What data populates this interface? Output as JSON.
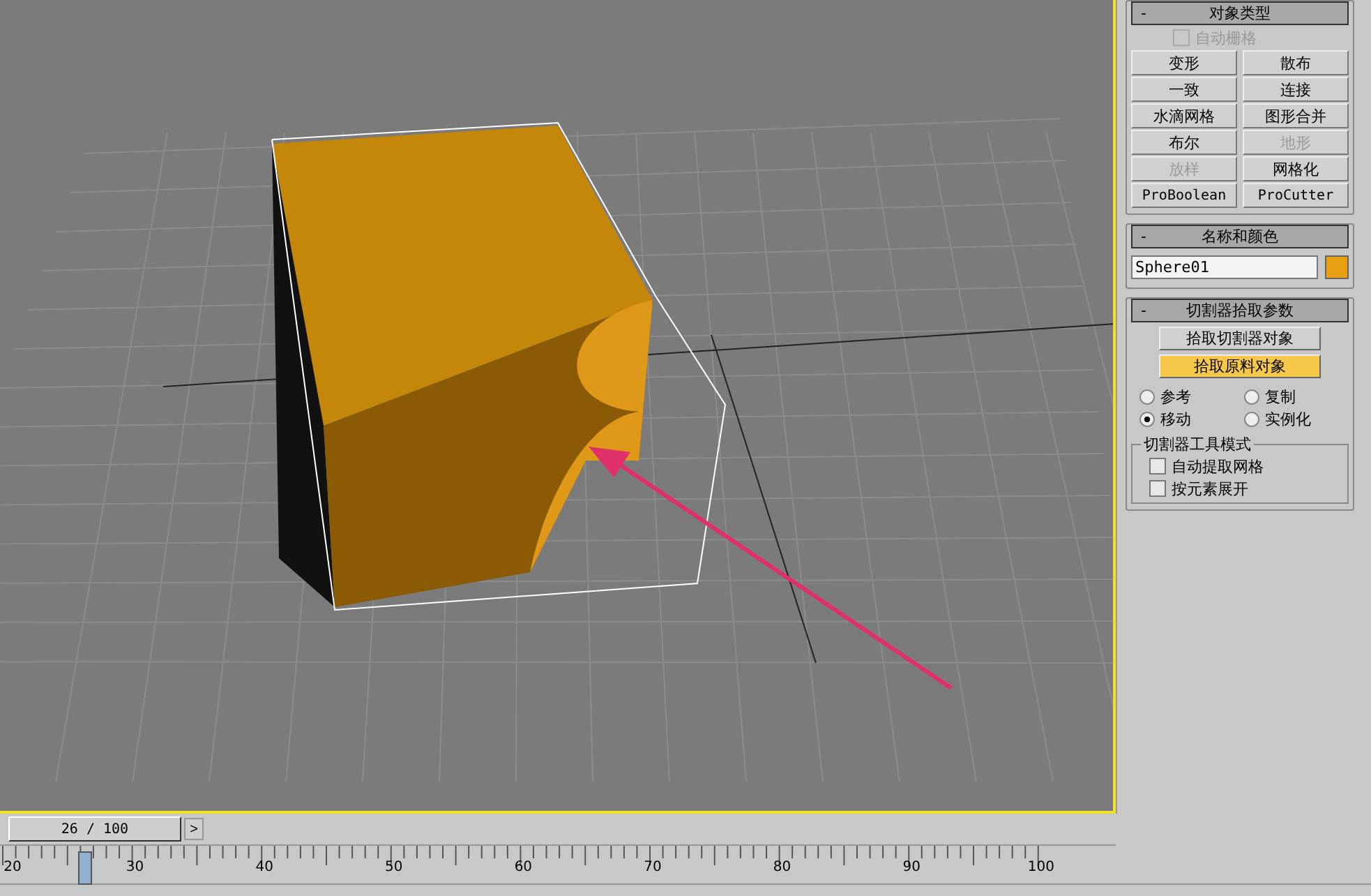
{
  "panel": {
    "object_type": {
      "collapse": "-",
      "title": "对象类型",
      "autogrid": {
        "label": "自动栅格",
        "checked": false,
        "disabled": true
      },
      "buttons": [
        {
          "label": "变形",
          "disabled": false,
          "kind": "text"
        },
        {
          "label": "散布",
          "disabled": false,
          "kind": "text"
        },
        {
          "label": "一致",
          "disabled": false,
          "kind": "text"
        },
        {
          "label": "连接",
          "disabled": false,
          "kind": "text"
        },
        {
          "label": "水滴网格",
          "disabled": false,
          "kind": "text"
        },
        {
          "label": "图形合并",
          "disabled": false,
          "kind": "text"
        },
        {
          "label": "布尔",
          "disabled": false,
          "kind": "text"
        },
        {
          "label": "地形",
          "disabled": true,
          "kind": "text"
        },
        {
          "label": "放样",
          "disabled": true,
          "kind": "text"
        },
        {
          "label": "网格化",
          "disabled": false,
          "kind": "text"
        },
        {
          "label": "ProBoolean",
          "disabled": false,
          "kind": "mono"
        },
        {
          "label": "ProCutter",
          "disabled": false,
          "kind": "mono"
        }
      ]
    },
    "name_color": {
      "collapse": "-",
      "title": "名称和颜色",
      "name": "Sphere01",
      "color": "#e8a010"
    },
    "cutter": {
      "collapse": "-",
      "title": "切割器拾取参数",
      "pick_buttons": [
        {
          "label": "拾取切割器对象",
          "selected": false
        },
        {
          "label": "拾取原料对象",
          "selected": true
        }
      ],
      "radios": [
        {
          "label": "参考",
          "selected": false
        },
        {
          "label": "复制",
          "selected": false
        },
        {
          "label": "移动",
          "selected": true
        },
        {
          "label": "实例化",
          "selected": false
        }
      ],
      "mode": {
        "title": "切割器工具模式",
        "options": [
          {
            "label": "自动提取网格",
            "checked": false
          },
          {
            "label": "按元素展开",
            "checked": false
          }
        ]
      }
    }
  },
  "timeline": {
    "frame": "26 / 100",
    "level": 0.075,
    "next": ">",
    "ruler": [
      "20",
      "30",
      "40",
      "50",
      "60",
      "70",
      "80",
      "90",
      "100"
    ]
  }
}
